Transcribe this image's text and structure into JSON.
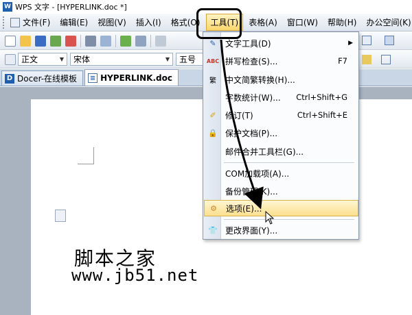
{
  "window": {
    "title": "WPS 文字 - [HYPERLINK.doc *]",
    "app_icon": "W"
  },
  "menubar": {
    "items": [
      {
        "label": "文件(F)"
      },
      {
        "label": "编辑(E)"
      },
      {
        "label": "视图(V)"
      },
      {
        "label": "插入(I)"
      },
      {
        "label": "格式(O)"
      },
      {
        "label": "工具(T)"
      },
      {
        "label": "表格(A)"
      },
      {
        "label": "窗口(W)"
      },
      {
        "label": "帮助(H)"
      },
      {
        "label": "办公空间(K)"
      }
    ],
    "active_index": 5
  },
  "toolbar2": {
    "style_value": "正文",
    "font_value": "宋体",
    "size_value": "五号"
  },
  "tabs": [
    {
      "label": "Docer-在线模板",
      "icon": "D"
    },
    {
      "label": "HYPERLINK.doc"
    }
  ],
  "dropdown": {
    "items": [
      {
        "label": "文字工具(D)",
        "shortcut": "",
        "submenu": true,
        "icon": "text-tool-icon"
      },
      {
        "label": "拼写检查(S)...",
        "shortcut": "F7",
        "icon": "spellcheck-icon"
      },
      {
        "label": "中文简繁转换(H)...",
        "shortcut": "",
        "icon": "chinese-convert-icon"
      },
      {
        "label": "字数统计(W)...",
        "shortcut": "Ctrl+Shift+G",
        "icon": ""
      },
      {
        "label": "修订(T)",
        "shortcut": "Ctrl+Shift+E",
        "icon": "track-changes-icon"
      },
      {
        "label": "保护文档(P)...",
        "shortcut": "",
        "icon": "protect-document-icon"
      },
      {
        "label": "邮件合并工具栏(G)...",
        "shortcut": "",
        "icon": ""
      },
      {
        "label": "COM加载项(A)...",
        "shortcut": "",
        "icon": ""
      },
      {
        "label": "备份管理(K)...",
        "shortcut": "",
        "icon": ""
      },
      {
        "label": "选项(E)...",
        "shortcut": "",
        "icon": "options-gear-icon",
        "highlighted": true
      },
      {
        "label": "更改界面(Y)...",
        "shortcut": "",
        "icon": "change-ui-icon"
      }
    ]
  },
  "watermark": {
    "text_cn": "脚本之家",
    "text_url": "www.jb51.net"
  },
  "colors": {
    "highlight": "#fbe08e",
    "menubar": "#dfe6ef",
    "tabbar": "#c9d6e6",
    "workspace": "#a9b3c0"
  }
}
